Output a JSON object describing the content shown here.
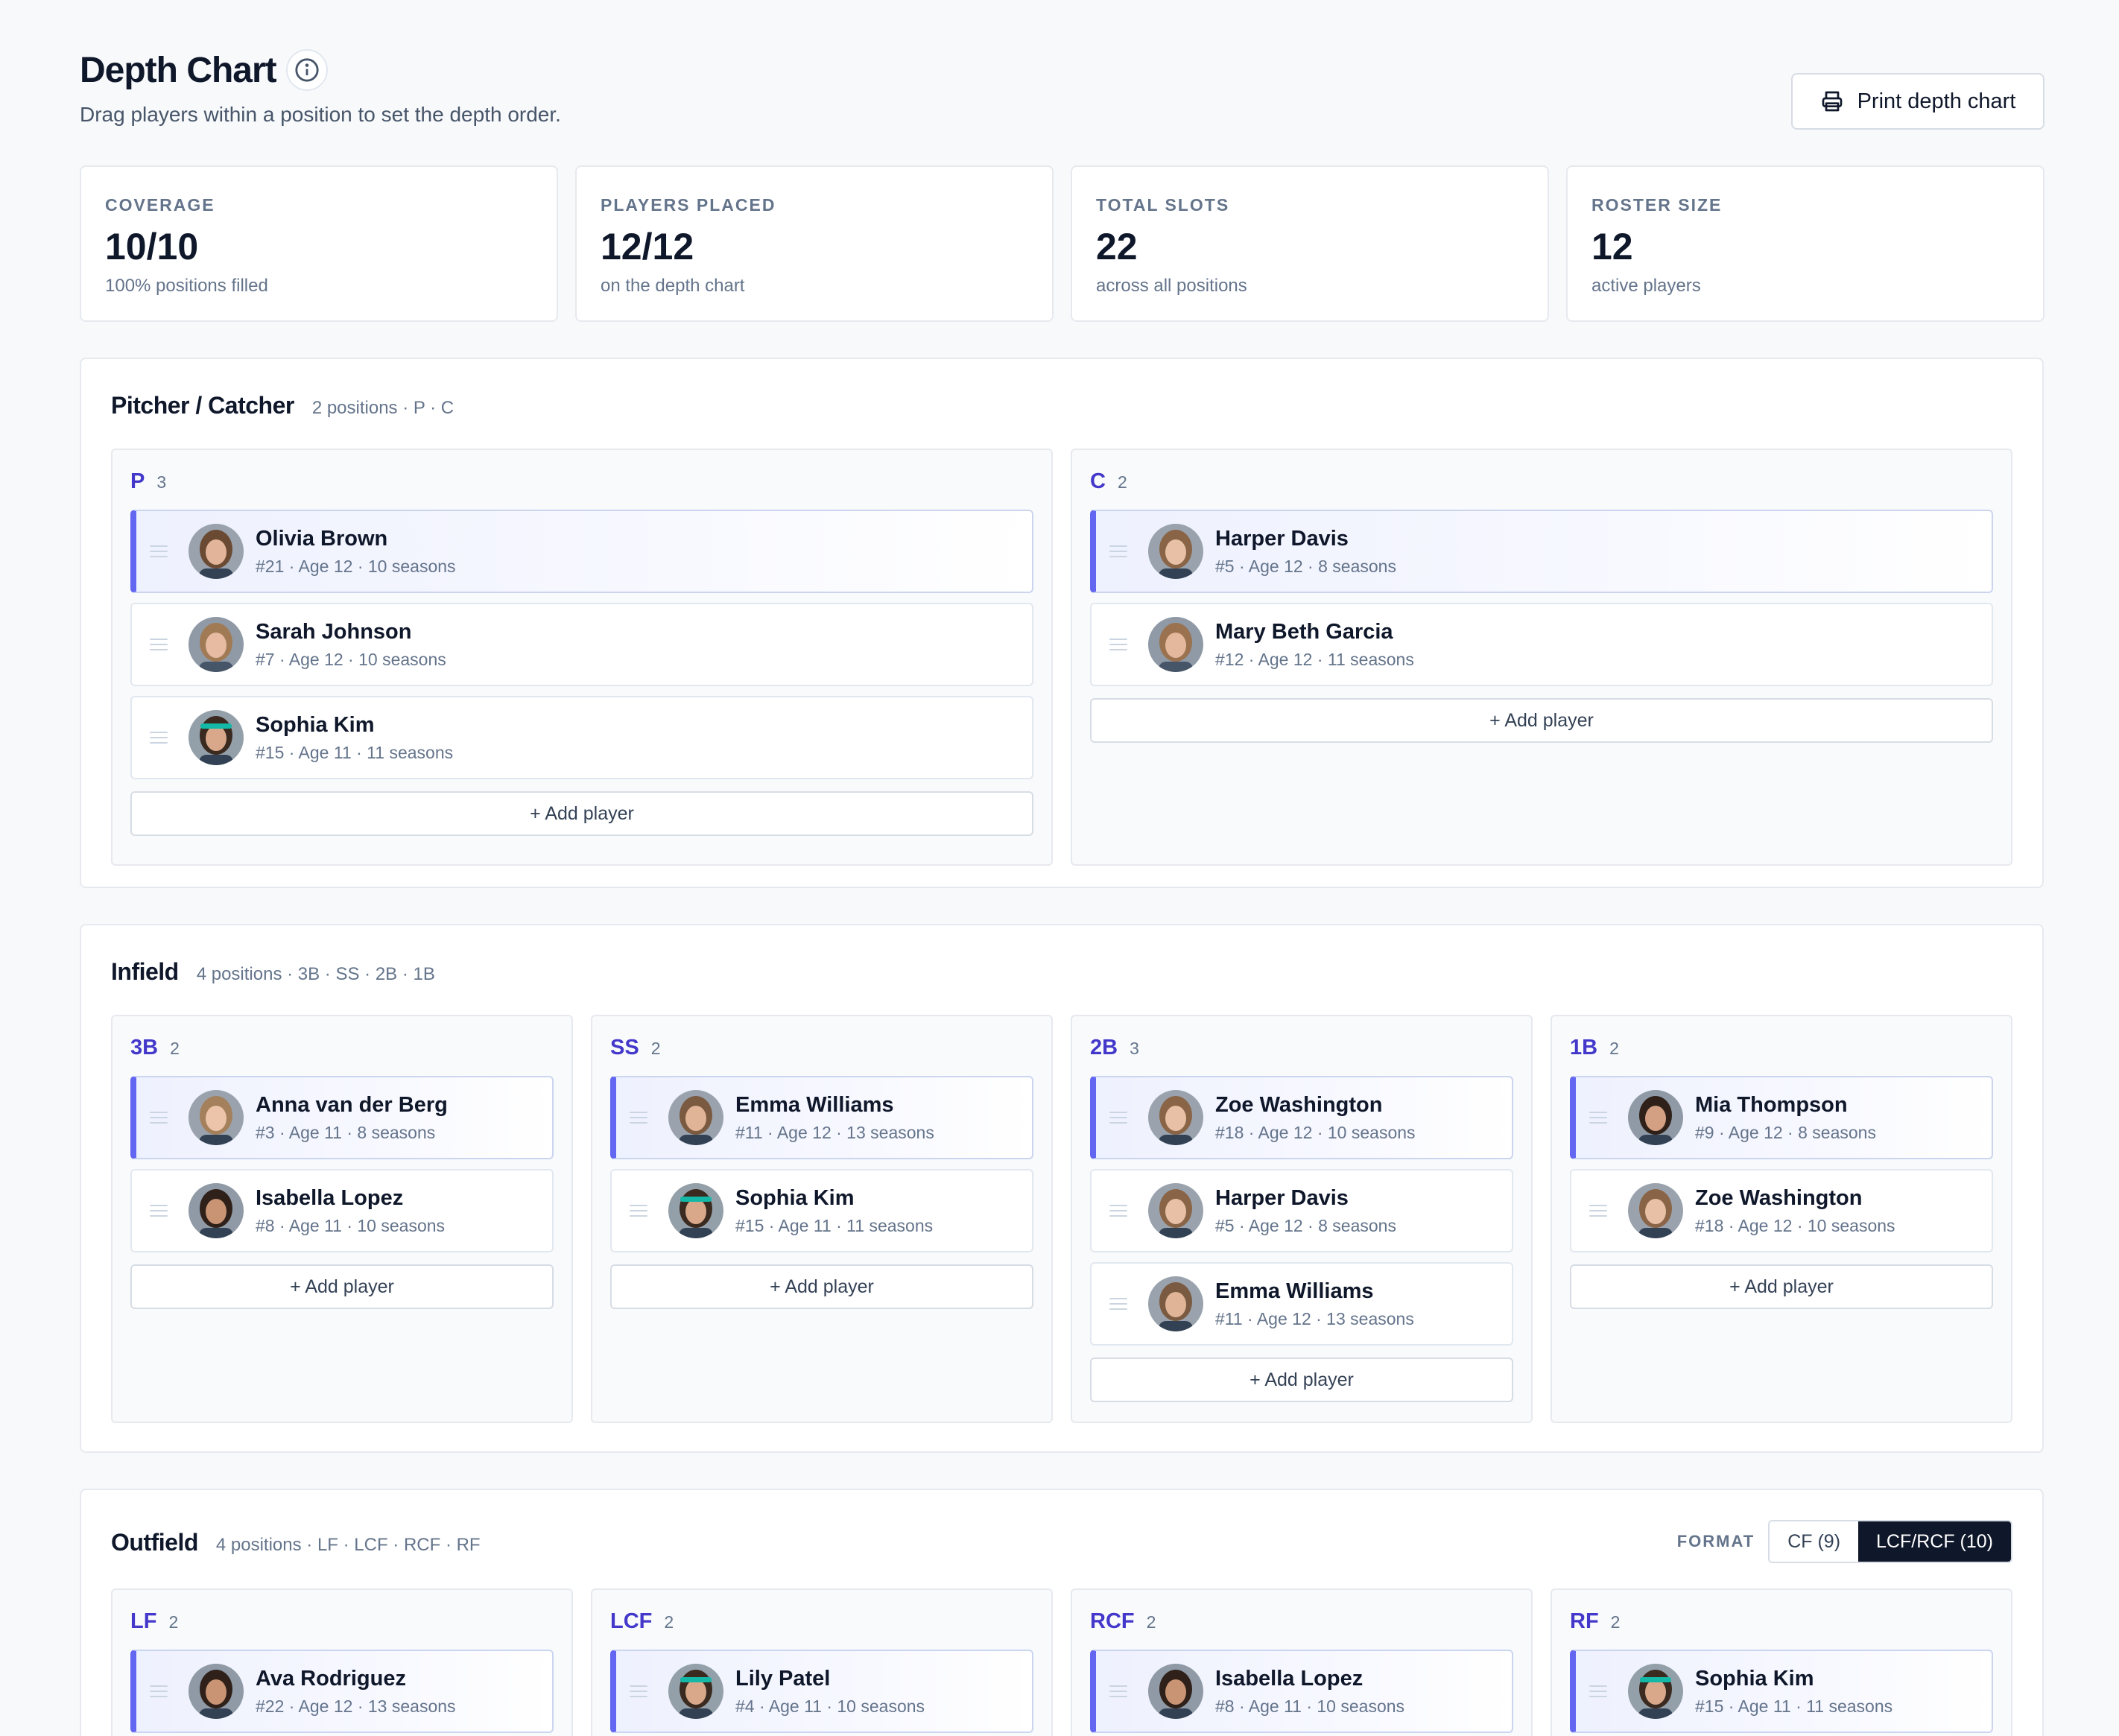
{
  "header": {
    "title": "Depth Chart",
    "subtitle": "Drag players within a position to set the depth order.",
    "print_label": "Print depth chart",
    "info_icon": "info-icon",
    "print_icon": "printer-icon"
  },
  "stats": [
    {
      "label": "COVERAGE",
      "value": "10/10",
      "sub": "100% positions filled"
    },
    {
      "label": "PLAYERS PLACED",
      "value": "12/12",
      "sub": "on the depth chart"
    },
    {
      "label": "TOTAL SLOTS",
      "value": "22",
      "sub": "across all positions"
    },
    {
      "label": "ROSTER SIZE",
      "value": "12",
      "sub": "active players"
    }
  ],
  "add_label": "+ Add player",
  "colors": {
    "accent": "#4338ca",
    "bar": "#6366f1",
    "dark": "#0f172a"
  },
  "groups": [
    {
      "title": "Pitcher / Catcher",
      "meta": "2 positions · P · C",
      "positions": [
        {
          "code": "P",
          "count": "3",
          "players": [
            {
              "name": "Olivia Brown",
              "meta": "#21 · Age 12 · 10 seasons"
            },
            {
              "name": "Sarah Johnson",
              "meta": "#7 · Age 12 · 10 seasons"
            },
            {
              "name": "Sophia Kim",
              "meta": "#15 · Age 11 · 11 seasons"
            }
          ]
        },
        {
          "code": "C",
          "count": "2",
          "players": [
            {
              "name": "Harper Davis",
              "meta": "#5 · Age 12 · 8 seasons"
            },
            {
              "name": "Mary Beth Garcia",
              "meta": "#12 · Age 12 · 11 seasons"
            }
          ]
        }
      ]
    },
    {
      "title": "Infield",
      "meta": "4 positions · 3B · SS · 2B · 1B",
      "positions": [
        {
          "code": "3B",
          "count": "2",
          "players": [
            {
              "name": "Anna van der Berg",
              "meta": "#3 · Age 11 · 8 seasons"
            },
            {
              "name": "Isabella Lopez",
              "meta": "#8 · Age 11 · 10 seasons"
            }
          ]
        },
        {
          "code": "SS",
          "count": "2",
          "players": [
            {
              "name": "Emma Williams",
              "meta": "#11 · Age 12 · 13 seasons"
            },
            {
              "name": "Sophia Kim",
              "meta": "#15 · Age 11 · 11 seasons"
            }
          ]
        },
        {
          "code": "2B",
          "count": "3",
          "players": [
            {
              "name": "Zoe Washington",
              "meta": "#18 · Age 12 · 10 seasons"
            },
            {
              "name": "Harper Davis",
              "meta": "#5 · Age 12 · 8 seasons"
            },
            {
              "name": "Emma Williams",
              "meta": "#11 · Age 12 · 13 seasons"
            }
          ]
        },
        {
          "code": "1B",
          "count": "2",
          "players": [
            {
              "name": "Mia Thompson",
              "meta": "#9 · Age 12 · 8 seasons"
            },
            {
              "name": "Zoe Washington",
              "meta": "#18 · Age 12 · 10 seasons"
            }
          ]
        }
      ]
    },
    {
      "title": "Outfield",
      "meta": "4 positions · LF · LCF · RCF · RF",
      "format": {
        "label": "FORMAT",
        "options": [
          "CF (9)",
          "LCF/RCF (10)"
        ],
        "selected": "LCF/RCF (10)"
      },
      "positions": [
        {
          "code": "LF",
          "count": "2",
          "players": [
            {
              "name": "Ava Rodriguez",
              "meta": "#22 · Age 12 · 13 seasons"
            }
          ]
        },
        {
          "code": "LCF",
          "count": "2",
          "players": [
            {
              "name": "Lily Patel",
              "meta": "#4 · Age 11 · 10 seasons"
            }
          ]
        },
        {
          "code": "RCF",
          "count": "2",
          "players": [
            {
              "name": "Isabella Lopez",
              "meta": "#8 · Age 11 · 10 seasons"
            }
          ]
        },
        {
          "code": "RF",
          "count": "2",
          "players": [
            {
              "name": "Sophia Kim",
              "meta": "#15 · Age 11 · 11 seasons"
            }
          ]
        }
      ]
    }
  ]
}
